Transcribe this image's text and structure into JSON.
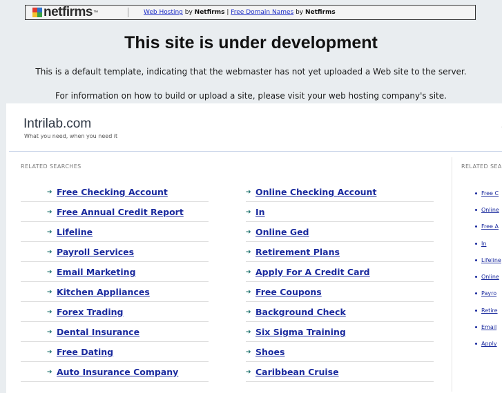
{
  "banner": {
    "logo_text": "netfirms",
    "link1": "Web Hosting",
    "by1": " by ",
    "brand1": "Netfirms",
    "sep": " | ",
    "link2": "Free Domain Names",
    "by2": " by ",
    "brand2": "Netfirms"
  },
  "headline": "This site is under development",
  "subline1": "This is a default template, indicating that the webmaster has not yet uploaded a Web site to the server.",
  "subline2": "For information on how to build or upload a site, please visit your web hosting company's site.",
  "panel": {
    "brand": "Intrilab.com",
    "tagline": "What you need, when you need it",
    "left_label": "RELATED SEARCHES",
    "right_label": "RELATED SEARCHES",
    "col1": [
      "Free Checking Account",
      "Free Annual Credit Report",
      "Lifeline",
      "Payroll Services",
      "Email Marketing",
      "Kitchen Appliances",
      "Forex Trading",
      "Dental Insurance",
      "Free Dating",
      "Auto Insurance Company"
    ],
    "col2": [
      "Online Checking Account",
      "In",
      "Online Ged",
      "Retirement Plans",
      "Apply For A Credit Card",
      "Free Coupons",
      "Background Check",
      "Six Sigma Training",
      "Shoes",
      "Caribbean Cruise"
    ],
    "side": [
      "Free C",
      "Online",
      "Free A",
      "In",
      "Lifeline",
      "Online",
      "Payro",
      "Retire",
      "Email",
      "Apply"
    ]
  }
}
